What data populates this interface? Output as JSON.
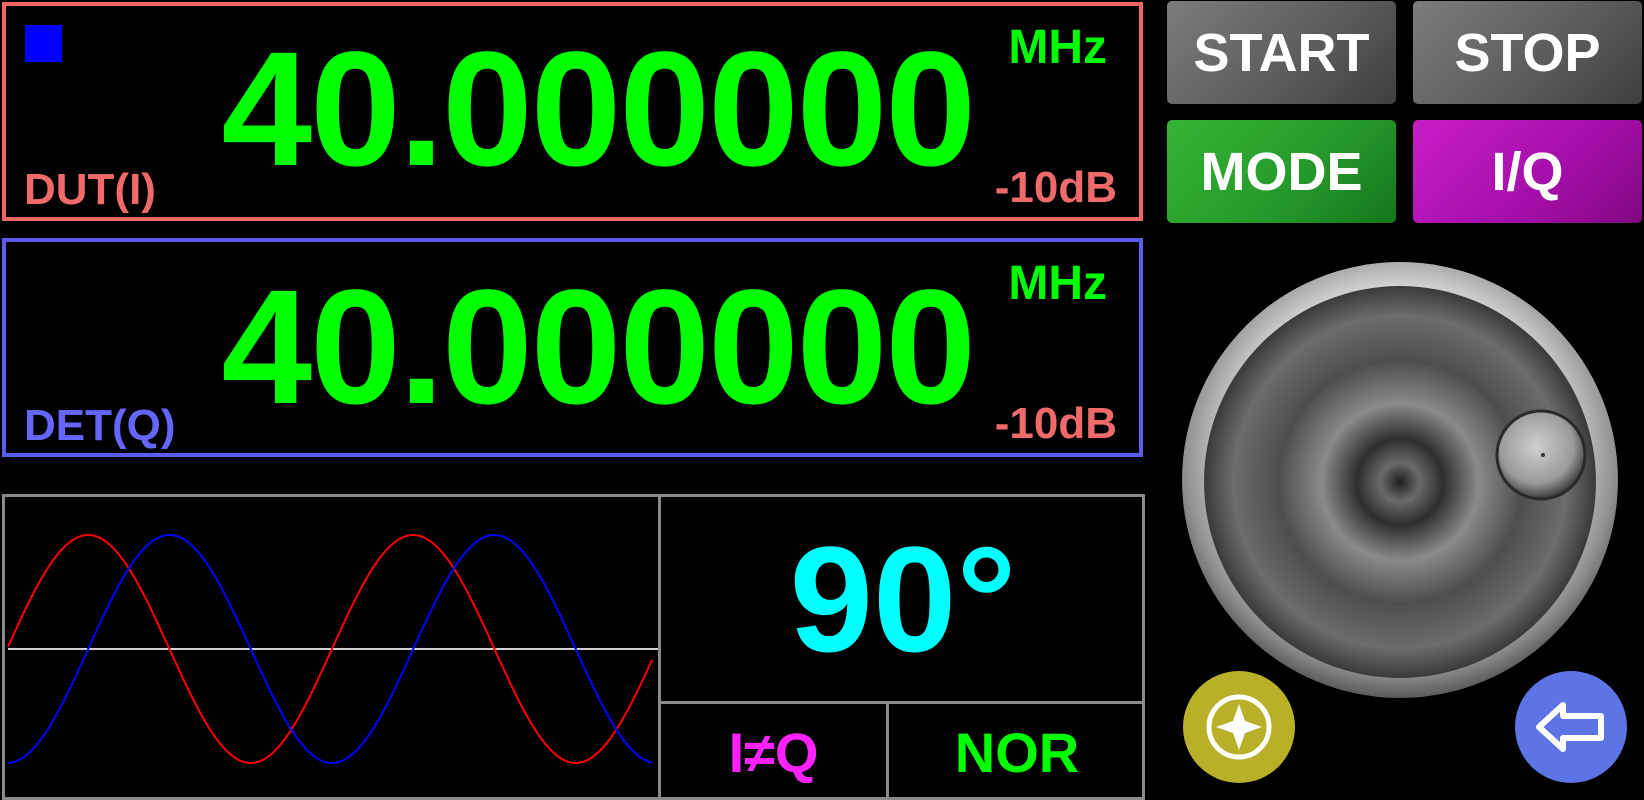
{
  "dut": {
    "frequency": "40.000000",
    "unit": "MHz",
    "level": "-10dB",
    "channel": "DUT(I)",
    "indicator_color": "#0000ff"
  },
  "det": {
    "frequency": "40.000000",
    "unit": "MHz",
    "level": "-10dB",
    "channel": "DET(Q)"
  },
  "buttons": {
    "start": "START",
    "stop": "STOP",
    "mode": "MODE",
    "iq": "I/Q"
  },
  "readouts": {
    "phase": "90°",
    "relation": "I≠Q",
    "mode_state": "NOR"
  },
  "colors": {
    "freq_text": "#00ff00",
    "dut_border": "#ee6666",
    "det_border": "#5c5cf0",
    "phase_text": "#00ffff",
    "i_trace": "#ff0000",
    "q_trace": "#0000ff"
  },
  "icons": {
    "nav": "crosshair-icon",
    "back": "back-arrow-icon"
  }
}
